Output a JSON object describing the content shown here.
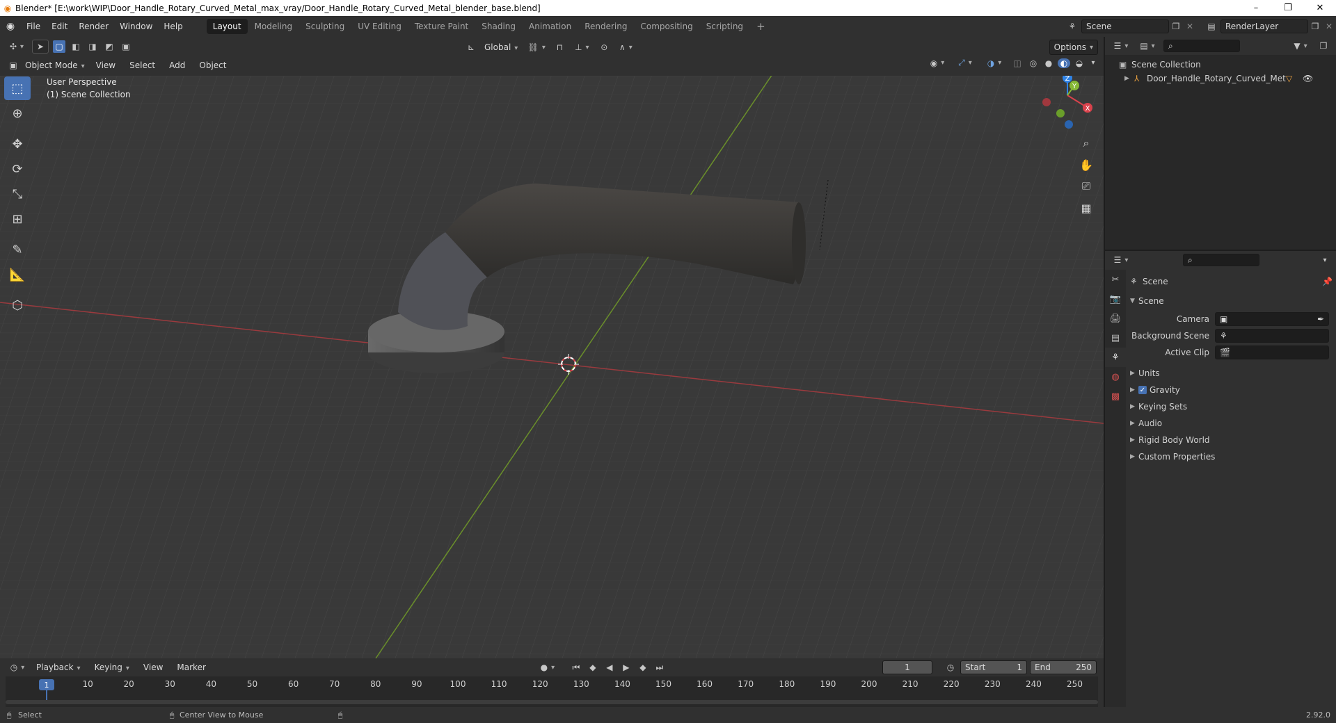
{
  "window": {
    "title": "Blender* [E:\\work\\WIP\\Door_Handle_Rotary_Curved_Metal_max_vray/Door_Handle_Rotary_Curved_Metal_blender_base.blend]",
    "minimize": "–",
    "restore": "❐",
    "close": "✕"
  },
  "menu": [
    "File",
    "Edit",
    "Render",
    "Window",
    "Help"
  ],
  "workspaces": [
    {
      "label": "Layout",
      "active": true
    },
    {
      "label": "Modeling"
    },
    {
      "label": "Sculpting"
    },
    {
      "label": "UV Editing"
    },
    {
      "label": "Texture Paint"
    },
    {
      "label": "Shading"
    },
    {
      "label": "Animation"
    },
    {
      "label": "Rendering"
    },
    {
      "label": "Compositing"
    },
    {
      "label": "Scripting"
    }
  ],
  "add_workspace": "+",
  "scene_selector": {
    "value": "Scene"
  },
  "render_layer": {
    "value": "RenderLayer"
  },
  "viewport_header": {
    "transform_orientation": "Global",
    "options": "Options",
    "mode": "Object Mode",
    "menus": [
      "View",
      "Select",
      "Add",
      "Object"
    ]
  },
  "viewport": {
    "perspective_label": "User Perspective",
    "collection_label": "(1) Scene Collection",
    "gizmo": {
      "x": "X",
      "y": "Y",
      "z": "Z"
    }
  },
  "outliner": {
    "root": "Scene Collection",
    "items": [
      {
        "label": "Door_Handle_Rotary_Curved_Metal"
      }
    ]
  },
  "properties": {
    "header": "Scene",
    "section": "Scene",
    "fields": [
      {
        "label": "Camera",
        "value": ""
      },
      {
        "label": "Background Scene",
        "value": ""
      },
      {
        "label": "Active Clip",
        "value": ""
      }
    ],
    "panels": [
      {
        "label": "Units",
        "checkbox": false
      },
      {
        "label": "Gravity",
        "checkbox": true
      },
      {
        "label": "Keying Sets",
        "checkbox": false
      },
      {
        "label": "Audio",
        "checkbox": false
      },
      {
        "label": "Rigid Body World",
        "checkbox": false
      },
      {
        "label": "Custom Properties",
        "checkbox": false
      }
    ]
  },
  "timeline": {
    "menus": [
      "Playback",
      "Keying",
      "View",
      "Marker"
    ],
    "current_frame": "1",
    "start_label": "Start",
    "start": "1",
    "end_label": "End",
    "end": "250",
    "ticks": [
      "10",
      "20",
      "30",
      "40",
      "50",
      "60",
      "70",
      "80",
      "90",
      "100",
      "110",
      "120",
      "130",
      "140",
      "150",
      "160",
      "170",
      "180",
      "190",
      "200",
      "210",
      "220",
      "230",
      "240",
      "250"
    ],
    "current_marker": "1"
  },
  "statusbar": {
    "left": "Select",
    "middle": "Center View to Mouse",
    "version": "2.92.0"
  },
  "colors": {
    "accent": "#4772b3",
    "x_axis": "#d9424c",
    "y_axis": "#86b836",
    "z_axis": "#2f83e6"
  }
}
